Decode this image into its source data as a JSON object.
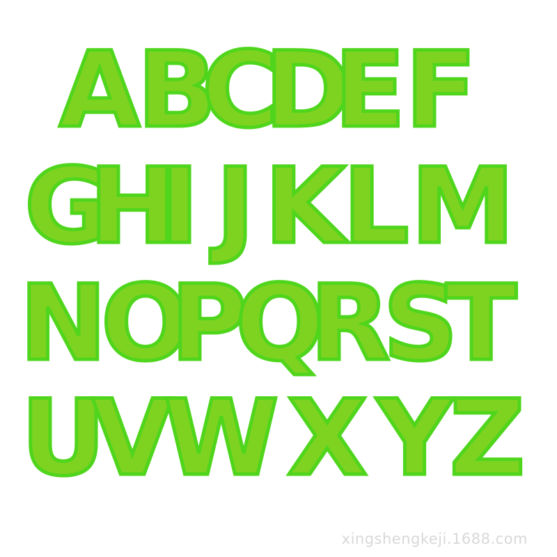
{
  "patch_color": "#7ed321",
  "patch_edge_color": "#4fd51c",
  "rows": [
    [
      "A",
      "B",
      "C",
      "D",
      "E",
      "F"
    ],
    [
      "G",
      "H",
      "I",
      "J",
      "K",
      "L",
      "M"
    ],
    [
      "N",
      "O",
      "P",
      "Q",
      "R",
      "S",
      "T"
    ],
    [
      "U",
      "V",
      "W",
      "X",
      "Y",
      "Z"
    ]
  ],
  "watermark": "xingshengkeji.1688.com"
}
